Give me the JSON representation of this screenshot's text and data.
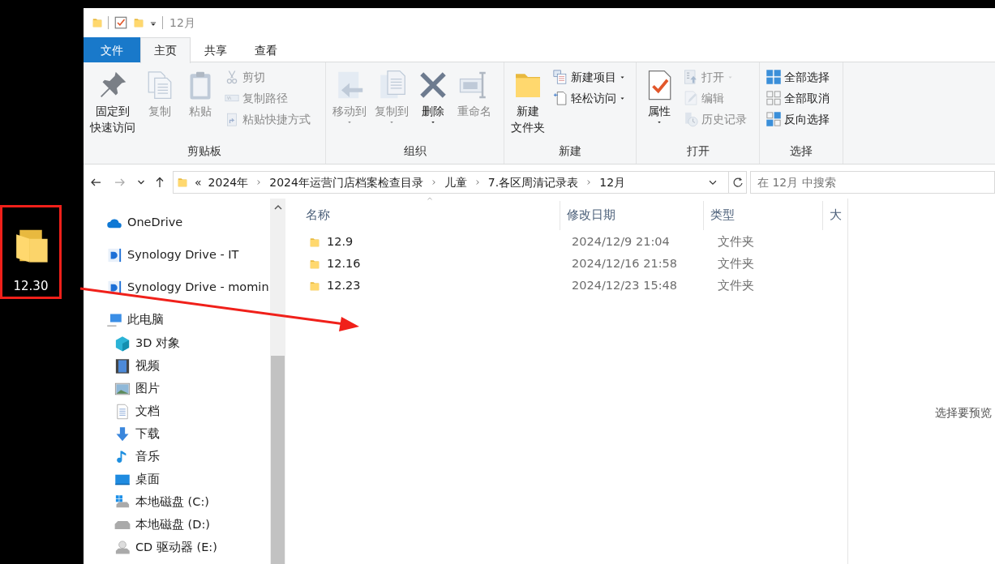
{
  "desktop_icon": {
    "label": "12.30",
    "highlighted": true
  },
  "window": {
    "title": "12月"
  },
  "ribbon_tabs": [
    {
      "label": "文件",
      "kind": "file",
      "selected": false
    },
    {
      "label": "主页",
      "kind": "tab",
      "selected": true
    },
    {
      "label": "共享",
      "kind": "tab",
      "selected": false
    },
    {
      "label": "查看",
      "kind": "tab",
      "selected": false
    }
  ],
  "ribbon_groups": [
    {
      "label": "剪贴板",
      "items": [
        {
          "kind": "large",
          "lines": [
            "固定到",
            "快速访问"
          ],
          "disabled": false,
          "dropdown": false
        },
        {
          "kind": "large",
          "lines": [
            "复制"
          ],
          "disabled": true,
          "dropdown": false
        },
        {
          "kind": "large",
          "lines": [
            "粘贴"
          ],
          "disabled": true,
          "dropdown": false
        },
        {
          "kind": "small",
          "lines": [
            "剪切"
          ],
          "disabled": true,
          "dropdown": false
        },
        {
          "kind": "small",
          "lines": [
            "复制路径"
          ],
          "disabled": true,
          "dropdown": false
        },
        {
          "kind": "small",
          "lines": [
            "粘贴快捷方式"
          ],
          "disabled": true,
          "dropdown": false
        }
      ]
    },
    {
      "label": "组织",
      "items": [
        {
          "kind": "large",
          "lines": [
            "移动到"
          ],
          "disabled": true,
          "dropdown": true
        },
        {
          "kind": "large",
          "lines": [
            "复制到"
          ],
          "disabled": true,
          "dropdown": true
        },
        {
          "kind": "large",
          "lines": [
            "删除"
          ],
          "disabled": false,
          "dropdown": true
        },
        {
          "kind": "large",
          "lines": [
            "重命名"
          ],
          "disabled": true,
          "dropdown": false
        }
      ]
    },
    {
      "label": "新建",
      "items": [
        {
          "kind": "large",
          "lines": [
            "新建",
            "文件夹"
          ],
          "disabled": false,
          "dropdown": false
        },
        {
          "kind": "small",
          "lines": [
            "新建项目"
          ],
          "disabled": false,
          "dropdown": true
        },
        {
          "kind": "small",
          "lines": [
            "轻松访问"
          ],
          "disabled": false,
          "dropdown": true
        }
      ]
    },
    {
      "label": "打开",
      "items": [
        {
          "kind": "large",
          "lines": [
            "属性"
          ],
          "disabled": false,
          "dropdown": true
        },
        {
          "kind": "small",
          "lines": [
            "打开"
          ],
          "disabled": true,
          "dropdown": true
        },
        {
          "kind": "small",
          "lines": [
            "编辑"
          ],
          "disabled": true,
          "dropdown": false
        },
        {
          "kind": "small",
          "lines": [
            "历史记录"
          ],
          "disabled": true,
          "dropdown": false
        }
      ]
    },
    {
      "label": "选择",
      "items": [
        {
          "kind": "small",
          "lines": [
            "全部选择"
          ],
          "disabled": false,
          "dropdown": false
        },
        {
          "kind": "small",
          "lines": [
            "全部取消"
          ],
          "disabled": false,
          "dropdown": false
        },
        {
          "kind": "small",
          "lines": [
            "反向选择"
          ],
          "disabled": false,
          "dropdown": false
        }
      ]
    }
  ],
  "address_bar": {
    "overflow": "«",
    "path": [
      "2024年",
      "2024年运营门店档案检查目录",
      "儿童",
      "7.各区周清记录表",
      "12月"
    ]
  },
  "search": {
    "placeholder": "在 12月 中搜索"
  },
  "nav_pane": [
    {
      "label": "OneDrive"
    },
    {
      "label": "Synology Drive - IT"
    },
    {
      "label": "Synology Drive - momin"
    },
    {
      "label": "此电脑",
      "children": [
        {
          "label": "3D 对象"
        },
        {
          "label": "视频"
        },
        {
          "label": "图片"
        },
        {
          "label": "文档"
        },
        {
          "label": "下载"
        },
        {
          "label": "音乐"
        },
        {
          "label": "桌面"
        },
        {
          "label": "本地磁盘 (C:)"
        },
        {
          "label": "本地磁盘 (D:)"
        },
        {
          "label": "CD 驱动器 (E:)"
        }
      ]
    }
  ],
  "table": {
    "columns": [
      "名称",
      "修改日期",
      "类型",
      "大"
    ],
    "rows": [
      {
        "name": "12.9",
        "modified": "2024/12/9 21:04",
        "type": "文件夹"
      },
      {
        "name": "12.16",
        "modified": "2024/12/16 21:58",
        "type": "文件夹"
      },
      {
        "name": "12.23",
        "modified": "2024/12/23 15:48",
        "type": "文件夹"
      }
    ]
  },
  "preview_pane": {
    "message": "选择要预览"
  }
}
